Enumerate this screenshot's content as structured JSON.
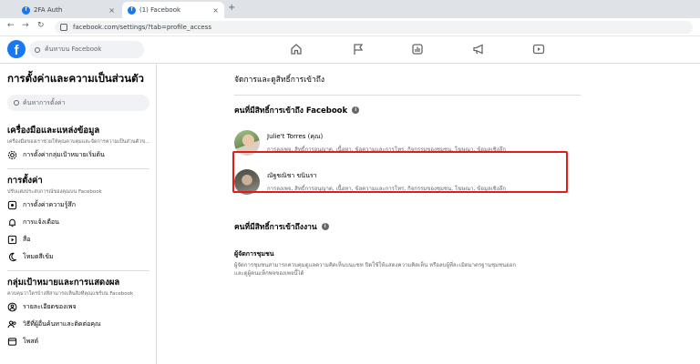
{
  "browser": {
    "tabs": [
      {
        "title": "2FA Auth",
        "close": "×"
      },
      {
        "title": "(1) Facebook",
        "close": "×"
      }
    ],
    "new_tab": "+",
    "nav": {
      "back": "←",
      "forward": "→",
      "reload": "↻"
    },
    "url": "facebook.com/settings/?tab=profile_access"
  },
  "fb": {
    "logo": "f",
    "search_placeholder": "ค้นหาบน Facebook"
  },
  "sidebar": {
    "title": "การตั้งค่าและความเป็นส่วนตัว",
    "search_placeholder": "ค้นหาการตั้งค่า",
    "sections": [
      {
        "title": "เครื่องมือและแหล่งข้อมูล",
        "desc": "เครื่องมือของเราช่วยให้คุณควบคุมและจัดการความเป็นส่วนตัวของคุณ",
        "items": [
          {
            "label": "การตั้งค่ากลุ่มเป้าหมายเริ่มต้น",
            "icon": "gear-icon"
          }
        ]
      },
      {
        "title": "การตั้งค่า",
        "desc": "ปรับแต่งประสบการณ์ของคุณบน Facebook",
        "items": [
          {
            "label": "การตั้งค่าความรู้สึก",
            "icon": "reaction-icon"
          },
          {
            "label": "การแจ้งเตือน",
            "icon": "bell-icon"
          },
          {
            "label": "สื่อ",
            "icon": "media-icon"
          },
          {
            "label": "โหมดสีเข้ม",
            "icon": "moon-icon"
          }
        ]
      },
      {
        "title": "กลุ่มเป้าหมายและการแสดงผล",
        "desc": "ควบคุมว่าใครบ้างที่สามารถเห็นสิ่งที่คุณแชร์บน Facebook",
        "items": [
          {
            "label": "รายละเอียดของเพจ",
            "icon": "profile-icon"
          },
          {
            "label": "วิธีที่ผู้อื่นค้นหาและติดต่อคุณ",
            "icon": "people-icon"
          },
          {
            "label": "โพสต์",
            "icon": "post-icon"
          }
        ]
      }
    ]
  },
  "main": {
    "heading": "จัดการและดูสิทธิ์การเข้าถึง",
    "access_section": {
      "title": "คนที่มีสิทธิ์การเข้าถึง Facebook",
      "people": [
        {
          "name": "Julie't Torres (คุณ)",
          "permissions": "การลงเพจ, สิทธิ์การอนุญาต, เนื้อหา, ข้อความและการโทร, กิจกรรมของชุมชน, โฆษณา, ข้อมูลเชิงลึก"
        },
        {
          "name": "ณัฐชณิชา ขนินรา",
          "permissions": "การลงเพจ, สิทธิ์การอนุญาต, เนื้อหา, ข้อความและการโทร, กิจกรรมของชุมชน, โฆษณา, ข้อมูลเชิงลึก"
        }
      ]
    },
    "task_section": {
      "title": "คนที่มีสิทธิ์การเข้าถึงงาน",
      "role_title": "ผู้จัดการชุมชน",
      "role_desc": "ผู้จัดการชุมชนสามารถควบคุมดูแลความคิดเห็นบนแชท ปิดใช้ให้แสดงความคิดเห็น หรือลบผู้ที่ละเมิดมาตรฐานชุมชนออก และดูผู้คนแท็กพจของเพจนี้ได้"
    },
    "info_glyph": "i"
  },
  "colors": {
    "fb_blue": "#1877f2",
    "highlight_red": "#e21b1b",
    "text_secondary": "#65676b"
  }
}
